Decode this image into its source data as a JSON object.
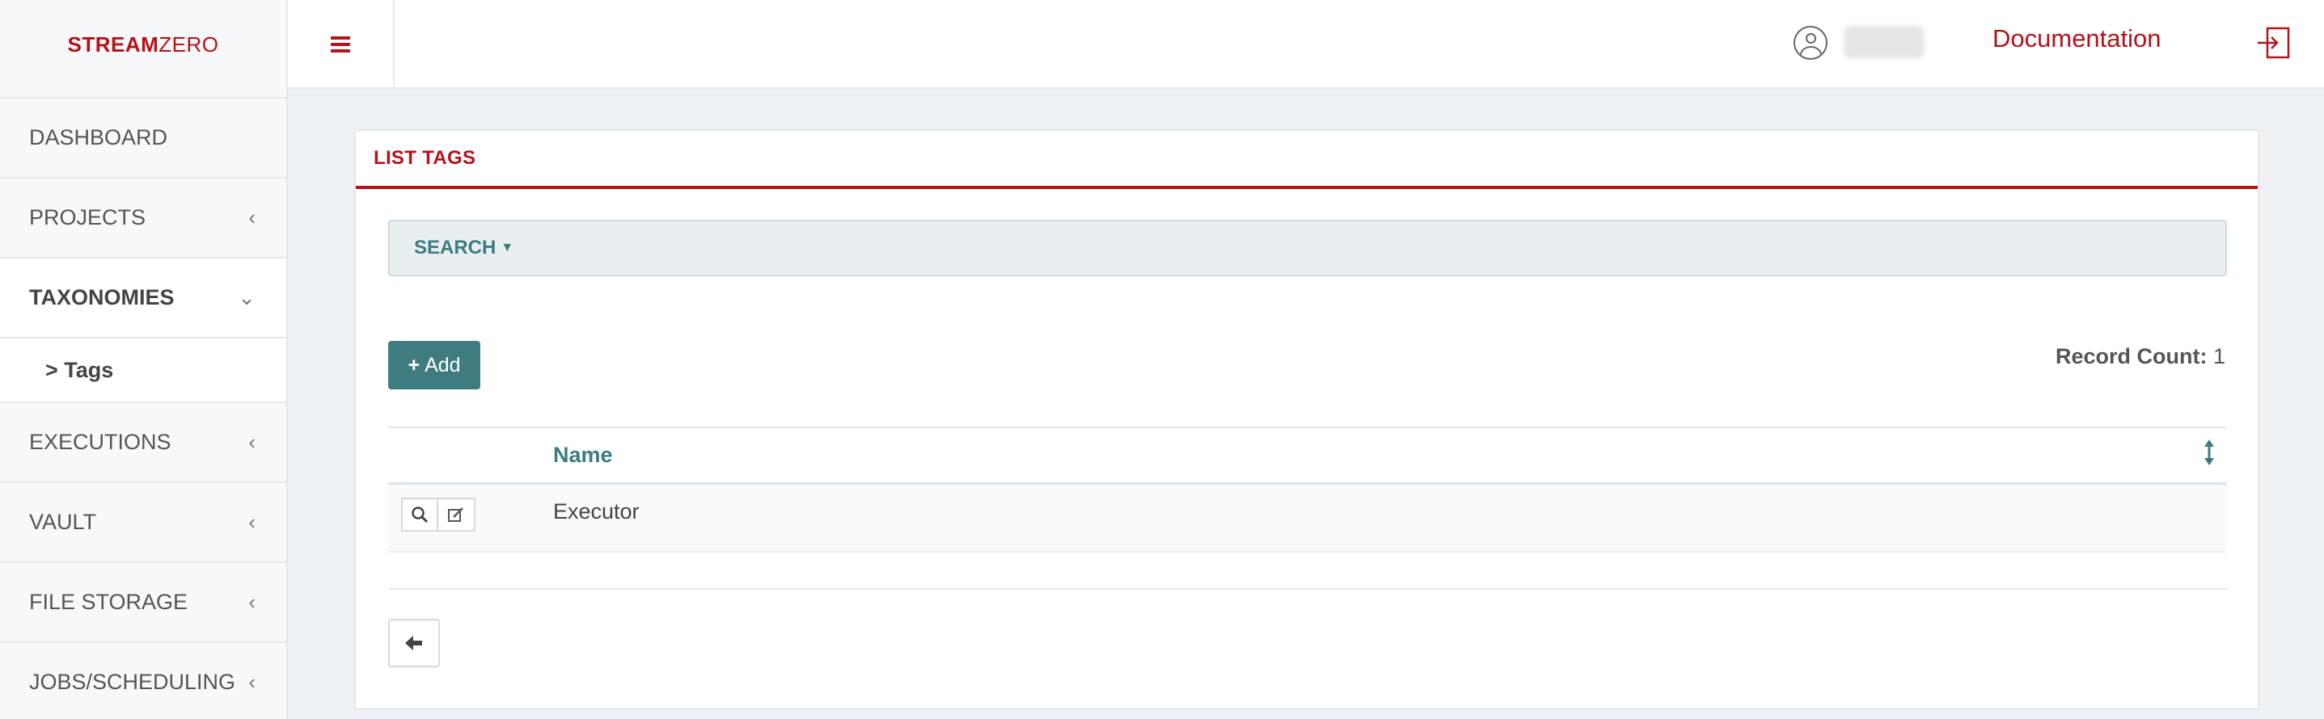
{
  "brand": {
    "part1": "STREAM",
    "part2": "ZERO"
  },
  "header": {
    "menu_icon": "hamburger-icon",
    "user_icon": "user-circle-icon",
    "documentation_label": "Documentation",
    "logout_icon": "sign-out-icon"
  },
  "sidebar": {
    "items": [
      {
        "label": "DASHBOARD",
        "chevron": ""
      },
      {
        "label": "PROJECTS",
        "chevron": "‹"
      },
      {
        "label": "TAXONOMIES",
        "chevron": "⌄"
      },
      {
        "label": "EXECUTIONS",
        "chevron": "‹"
      },
      {
        "label": "VAULT",
        "chevron": "‹"
      },
      {
        "label": "FILE STORAGE",
        "chevron": "‹"
      },
      {
        "label": "JOBS/SCHEDULING",
        "chevron": "‹"
      }
    ],
    "subitem": {
      "label": "> Tags"
    }
  },
  "panel": {
    "title": "LIST TAGS",
    "search_label": "SEARCH",
    "add_label": "Add",
    "record_count_label": "Record Count:",
    "record_count_value": "1"
  },
  "table": {
    "columns": [
      "Name"
    ],
    "rows": [
      {
        "name": "Executor"
      }
    ]
  },
  "colors": {
    "brand_red": "#b5121b",
    "teal": "#3f7c80",
    "background": "#edf1f4"
  }
}
